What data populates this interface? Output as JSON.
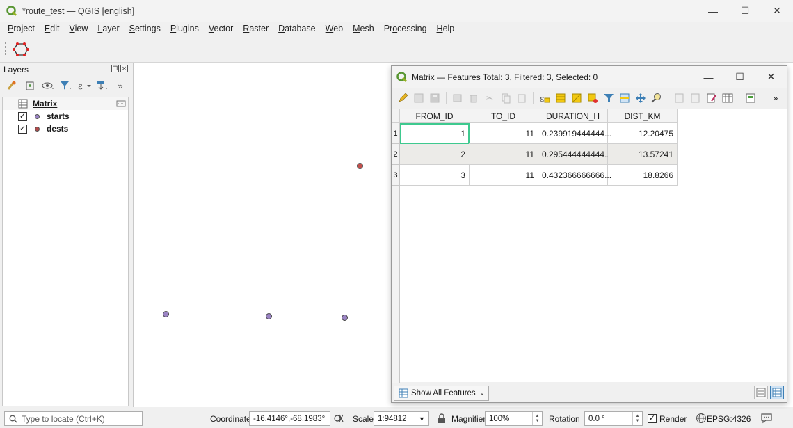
{
  "app": {
    "title": "*route_test — QGIS [english]",
    "controls": {
      "minimize": "—",
      "maximize": "☐",
      "close": "✕"
    }
  },
  "menu": [
    {
      "label": "Project",
      "u": "P",
      "rest": "roject"
    },
    {
      "label": "Edit",
      "u": "E",
      "rest": "dit"
    },
    {
      "label": "View",
      "u": "V",
      "rest": "iew"
    },
    {
      "label": "Layer",
      "u": "L",
      "rest": "ayer"
    },
    {
      "label": "Settings",
      "u": "S",
      "rest": "ettings"
    },
    {
      "label": "Plugins",
      "u": "P",
      "rest": "lugins"
    },
    {
      "label": "Vector",
      "u": "V",
      "rest": "ector"
    },
    {
      "label": "Raster",
      "u": "R",
      "rest": "aster"
    },
    {
      "label": "Database",
      "u": "D",
      "rest": "atabase"
    },
    {
      "label": "Web",
      "u": "W",
      "rest": "eb"
    },
    {
      "label": "Mesh",
      "u": "M",
      "rest": "esh"
    },
    {
      "label": "Processing",
      "u": "o",
      "pre": "Pr",
      "rest": "cessing"
    },
    {
      "label": "Help",
      "u": "H",
      "rest": "elp"
    }
  ],
  "layers": {
    "title": "Layers",
    "more": "»",
    "group": {
      "name": "Matrix"
    },
    "items": [
      {
        "name": "starts",
        "checked": "✓",
        "color": "#9b84c4"
      },
      {
        "name": "dests",
        "checked": "✓",
        "color": "#b34b4b"
      }
    ]
  },
  "map": {
    "points": [
      {
        "layer": "dests",
        "color": "#c0504d"
      },
      {
        "layer": "starts",
        "color": "#9b84c4"
      },
      {
        "layer": "starts",
        "color": "#9b84c4"
      },
      {
        "layer": "starts",
        "color": "#9b84c4"
      }
    ]
  },
  "attr_table": {
    "title": "Matrix — Features Total: 3, Filtered: 3, Selected: 0",
    "more": "»",
    "columns": [
      "FROM_ID",
      "TO_ID",
      "DURATION_H",
      "DIST_KM"
    ],
    "rows": [
      {
        "n": "1",
        "FROM_ID": "1",
        "TO_ID": "11",
        "DURATION_H": "0.239919444444...",
        "DIST_KM": "12.20475"
      },
      {
        "n": "2",
        "FROM_ID": "2",
        "TO_ID": "11",
        "DURATION_H": "0.295444444444...",
        "DIST_KM": "13.57241"
      },
      {
        "n": "3",
        "FROM_ID": "3",
        "TO_ID": "11",
        "DURATION_H": "0.432366666666...",
        "DIST_KM": "18.8266"
      }
    ],
    "show_all_label": "Show All Features"
  },
  "statusbar": {
    "locator_placeholder": "Type to locate (Ctrl+K)",
    "coordinate_label": "Coordinate",
    "coordinate_value": "-16.4146°,-68.1983°",
    "scale_label": "Scale",
    "scale_value": "1:94812",
    "magnifier_label": "Magnifier",
    "magnifier_value": "100%",
    "rotation_label": "Rotation",
    "rotation_value": "0.0 °",
    "render_label": "Render",
    "render_checked": "✓",
    "crs": "EPSG:4326"
  }
}
